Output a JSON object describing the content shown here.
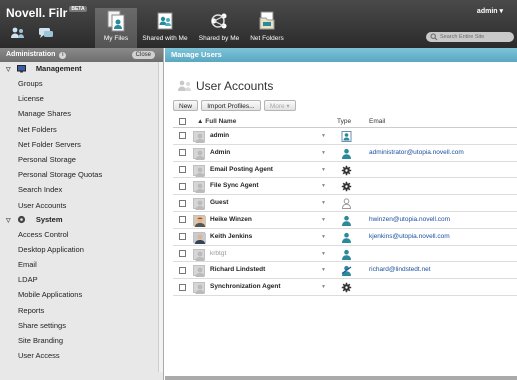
{
  "app": {
    "brand": "Novell. Filr",
    "beta_label": "BETA",
    "user": "admin ▾",
    "search_placeholder": "Search Entire Site"
  },
  "nav": [
    {
      "label": "My Files",
      "icon": "my-files-icon",
      "active": true
    },
    {
      "label": "Shared with Me",
      "icon": "shared-with-me-icon",
      "active": false
    },
    {
      "label": "Shared by Me",
      "icon": "shared-by-me-icon",
      "active": false
    },
    {
      "label": "Net Folders",
      "icon": "net-folders-icon",
      "active": false
    }
  ],
  "sidebar": {
    "title": "Administration",
    "info": "i",
    "close_label": "Close",
    "management_label": "Management",
    "management_items": [
      "Groups",
      "License",
      "Manage Shares",
      "Net Folders",
      "Net Folder Servers",
      "Personal Storage",
      "Personal Storage Quotas",
      "Search Index",
      "User Accounts"
    ],
    "system_label": "System",
    "system_items": [
      "Access Control",
      "Desktop Application",
      "Email",
      "LDAP",
      "Mobile Applications",
      "Reports",
      "Share settings",
      "Site Branding",
      "User Access"
    ]
  },
  "main": {
    "header": "Manage Users",
    "title": "User Accounts",
    "toolbar": {
      "new": "New",
      "import": "Import Profiles...",
      "more": "More ▾"
    },
    "columns": {
      "name": "Full Name",
      "type": "Type",
      "email": "Email"
    },
    "rows": [
      {
        "name": "admin",
        "type": "admin",
        "email": "",
        "muted": false
      },
      {
        "name": "Admin",
        "type": "user",
        "email": "administrator@utopia.novell.com",
        "muted": false
      },
      {
        "name": "Email Posting Agent",
        "type": "system",
        "email": "",
        "muted": false
      },
      {
        "name": "File Sync Agent",
        "type": "system",
        "email": "",
        "muted": false
      },
      {
        "name": "Guest",
        "type": "guest",
        "email": "",
        "muted": false
      },
      {
        "name": "Heike Winzen",
        "type": "user",
        "email": "hwinzen@utopia.novell.com",
        "muted": false
      },
      {
        "name": "Keith Jenkins",
        "type": "user",
        "email": "kjenkins@utopia.novell.com",
        "muted": false
      },
      {
        "name": "krbtgt",
        "type": "user",
        "email": "",
        "muted": true
      },
      {
        "name": "Richard Lindstedt",
        "type": "external",
        "email": "richard@lindstedt.net",
        "muted": false
      },
      {
        "name": "Synchronization Agent",
        "type": "system",
        "email": "",
        "muted": false
      }
    ]
  },
  "colors": {
    "accent": "#5aa7c2",
    "user_icon": "#2a8a9a",
    "link": "#1a4f9c"
  }
}
